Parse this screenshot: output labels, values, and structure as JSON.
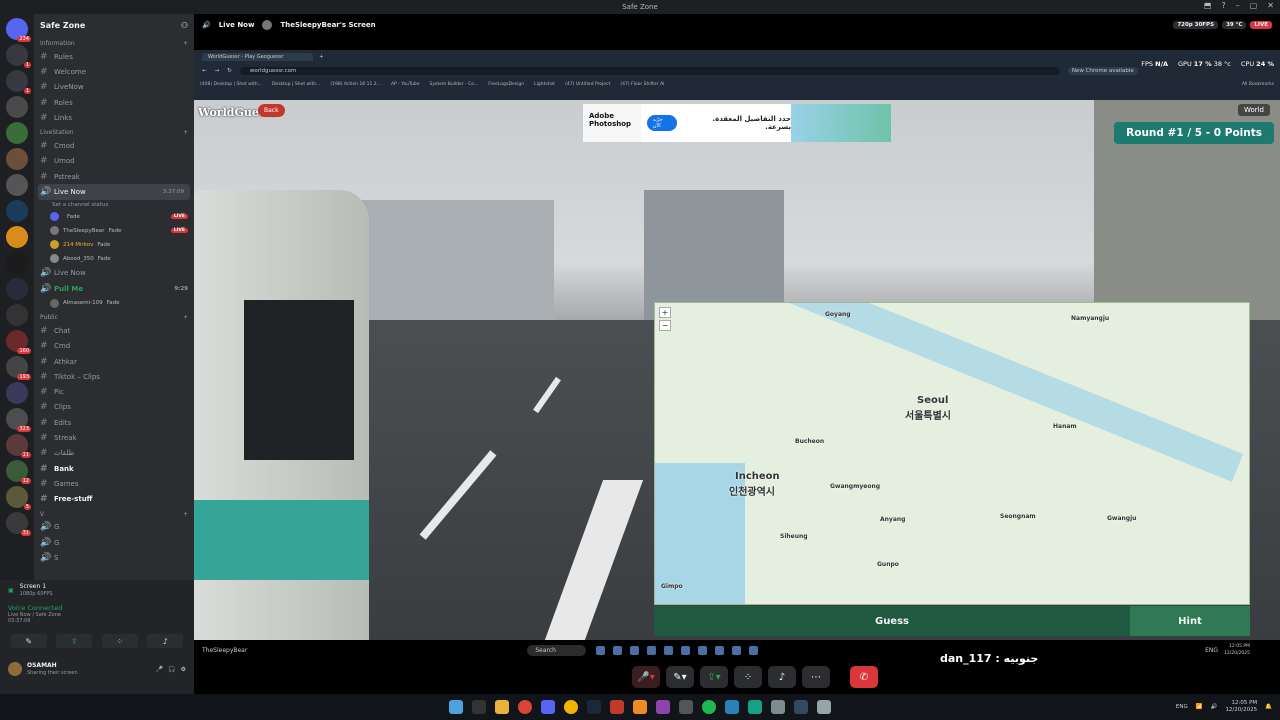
{
  "window": {
    "title": "Safe Zone"
  },
  "server": {
    "name": "Safe Zone"
  },
  "rail_badges": [
    "234",
    "1",
    "1",
    "160",
    "193",
    "323",
    "11",
    "12",
    "5",
    "31"
  ],
  "categories": {
    "information": "Information",
    "livestation": "LiveStation",
    "public": "Public",
    "voice": "V"
  },
  "info_channels": [
    "Rules",
    "Welcome",
    "LiveNow",
    "Roles",
    "Links"
  ],
  "livestation_channels": [
    "Cmod",
    "Umod",
    "Pstreak"
  ],
  "live_channel": {
    "name": "Live Now",
    "time": "3:37:09",
    "status": "Set a channel status"
  },
  "live_members": [
    {
      "name": "",
      "tag": "Fade",
      "live": "LIVE"
    },
    {
      "name": "TheSleepyBear",
      "tag": "Fade",
      "live": "LIVE"
    },
    {
      "name": "214 Mirkov",
      "tag": "Fade",
      "live": ""
    },
    {
      "name": "Abood_350",
      "tag": "Fade",
      "live": ""
    }
  ],
  "other_voice": [
    {
      "name": "Live Now",
      "time": ""
    },
    {
      "name": "Pull Me",
      "time": "9:29"
    }
  ],
  "pull_member": {
    "name": "Almasemi-109",
    "tag": "Fade"
  },
  "public_channels": [
    "Chat",
    "Cmd",
    "Athkar",
    "Tiktok – Clips",
    "Pic",
    "Clips",
    "Edits",
    "Streak",
    "ظلقات",
    "Bank",
    "Games",
    "Free-stuff"
  ],
  "voice_channels": [
    "G",
    "G",
    "S"
  ],
  "panel": {
    "screen_title": "Screen 1",
    "screen_sub": "1080p 60FPS",
    "voice_connected": "Voice Connected",
    "voice_location": "Live Now / Safe Zone",
    "voice_time": "03:37:09",
    "user_name": "OSAMAH",
    "user_status": "Sharing their screen"
  },
  "stream": {
    "live_now": "Live Now",
    "screen_name": "TheSleepyBear's Screen",
    "quality": "720p 30FPS",
    "temp": "39 °C",
    "live_badge": "LIVE"
  },
  "browser": {
    "tab_title": "WorldGuessr - Play Geoguessr",
    "url": "worldguessr.com",
    "bookmarks": [
      "(408) Desktop | Shot with...",
      "Desktop | Shot with...",
      "(198) Action 16 11 2...",
      "AP - YouTube",
      "System Builder - Co...",
      "FreeLogoDesign",
      "Lightshot",
      "(47) Untitled Project",
      "(47) Floor Shifter AI",
      "All Bookmarks"
    ],
    "new_chrome": "New Chrome available"
  },
  "hud": {
    "fps_label": "FPS",
    "fps_value": "N/A",
    "gpu_label": "GPU",
    "gpu_value": "17 %",
    "gpu_temp": "38 °c",
    "cpu_label": "CPU",
    "cpu_value": "24 %"
  },
  "ad": {
    "brand": "Adobe Photoshop",
    "cta": "جرّبه الآن",
    "text": "حدد التفاصيل المعقدة. بسرعة."
  },
  "game": {
    "logo": "WorldGuessr",
    "back": "Back",
    "world": "World",
    "round": "Round #1 / 5 - 0 Points",
    "guess": "Guess",
    "hint": "Hint"
  },
  "map_labels": {
    "seoul": "Seoul",
    "seoul_kr": "서울특별시",
    "incheon": "Incheon",
    "incheon_kr": "인천광역시",
    "goyang": "Goyang",
    "namyangju": "Namyangju",
    "hanam": "Hanam",
    "seongnam": "Seongnam",
    "gwangju": "Gwangju",
    "gwangmyeong": "Gwangmyeong",
    "anyang": "Anyang",
    "bucheon": "Bucheon",
    "siheung": "Siheung",
    "gunpo": "Gunpo",
    "gimpo": "Gimpo"
  },
  "inner_taskbar": {
    "name": "TheSleepyBear",
    "search": "Search",
    "lang": "ENG",
    "time": "12:05 PM",
    "date": "12/20/2025"
  },
  "caption": "جنوبيه : dan_117",
  "os_tray": {
    "lang": "ENG",
    "time": "12:05 PM",
    "date": "12/20/2025"
  },
  "colors": {
    "accent": "#1c7a6e",
    "live": "#da373c",
    "guess": "#1f5a40"
  }
}
